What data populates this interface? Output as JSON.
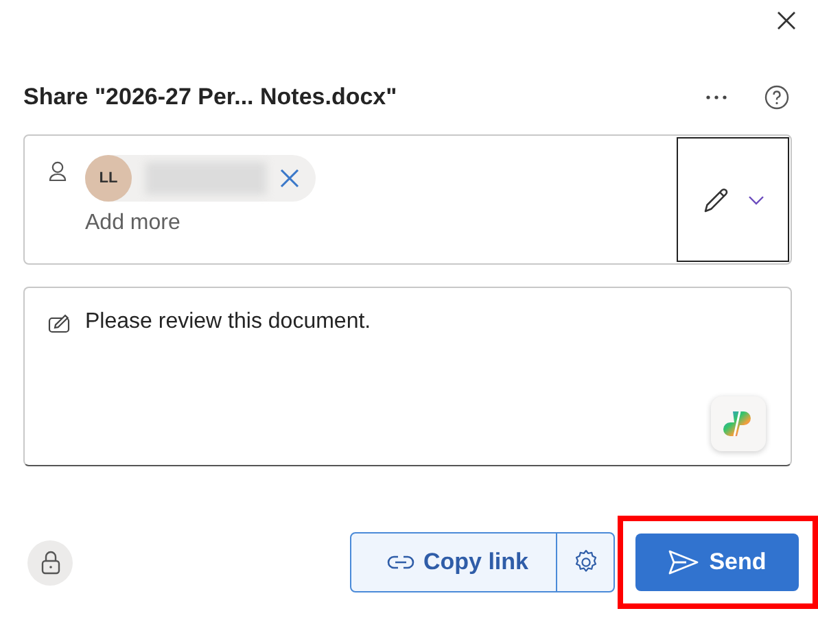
{
  "title": "Share \"2026-27 Per... Notes.docx\"",
  "recipients": [
    {
      "initials": "LL"
    }
  ],
  "add_more": {
    "placeholder": "Add more"
  },
  "message": {
    "value": "Please review this document."
  },
  "copy_link": "Copy link",
  "send": "Send"
}
